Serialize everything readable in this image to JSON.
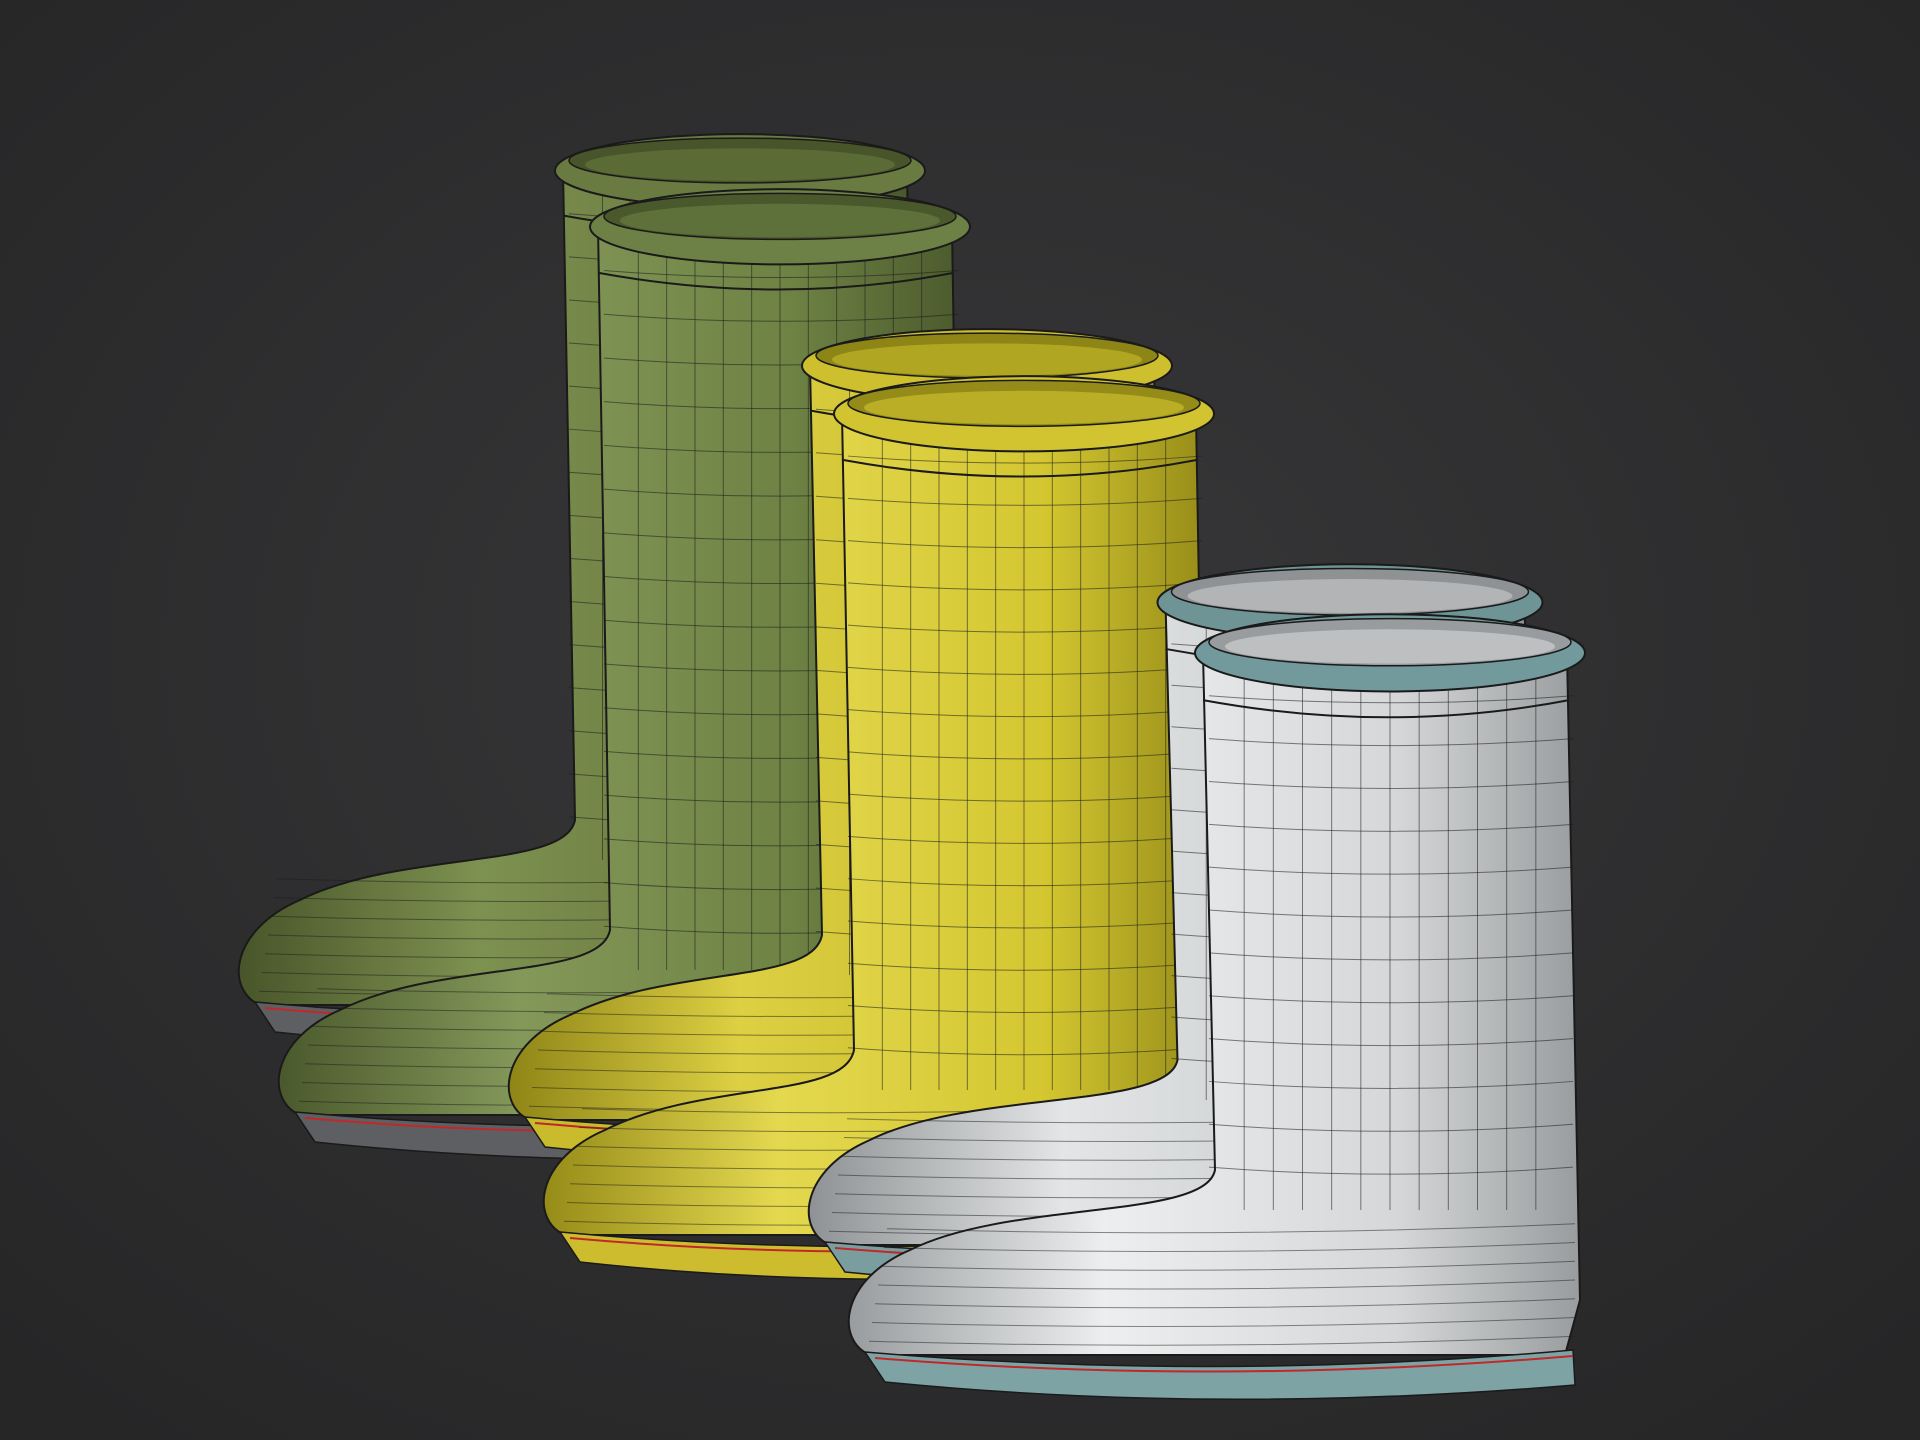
{
  "scene": {
    "background": "#2c2c2d",
    "wire_color": "#1c1c1c",
    "seam_color": "#c0282a",
    "boots": [
      {
        "name": "green-tall-back",
        "body": "#68793f",
        "light": "#7d9150",
        "dark": "#48552a",
        "collar": "#6a7b42",
        "sole": "#5e5f63"
      },
      {
        "name": "green-tall-front",
        "body": "#6e8244",
        "light": "#84985a",
        "dark": "#4a592c",
        "collar": "#6d8045",
        "sole": "#5e5f63"
      },
      {
        "name": "yellow-mid-back",
        "body": "#c8bc2a",
        "light": "#ddd043",
        "dark": "#8e8517",
        "collar": "#cdbf2e",
        "sole": "#c9bb2c"
      },
      {
        "name": "yellow-mid-front",
        "body": "#d4c731",
        "light": "#e4d84f",
        "dark": "#958b18",
        "collar": "#d2c330",
        "sole": "#cdbd2e"
      },
      {
        "name": "white-short-back",
        "body": "#c9cccd",
        "light": "#e3e5e6",
        "dark": "#8f9294",
        "collar": "#6e9496",
        "sole": "#7a9ea0"
      },
      {
        "name": "white-short-front",
        "body": "#d5d7d8",
        "light": "#eceeef",
        "dark": "#999c9e",
        "collar": "#72999b",
        "sole": "#7ea3a5"
      }
    ]
  }
}
